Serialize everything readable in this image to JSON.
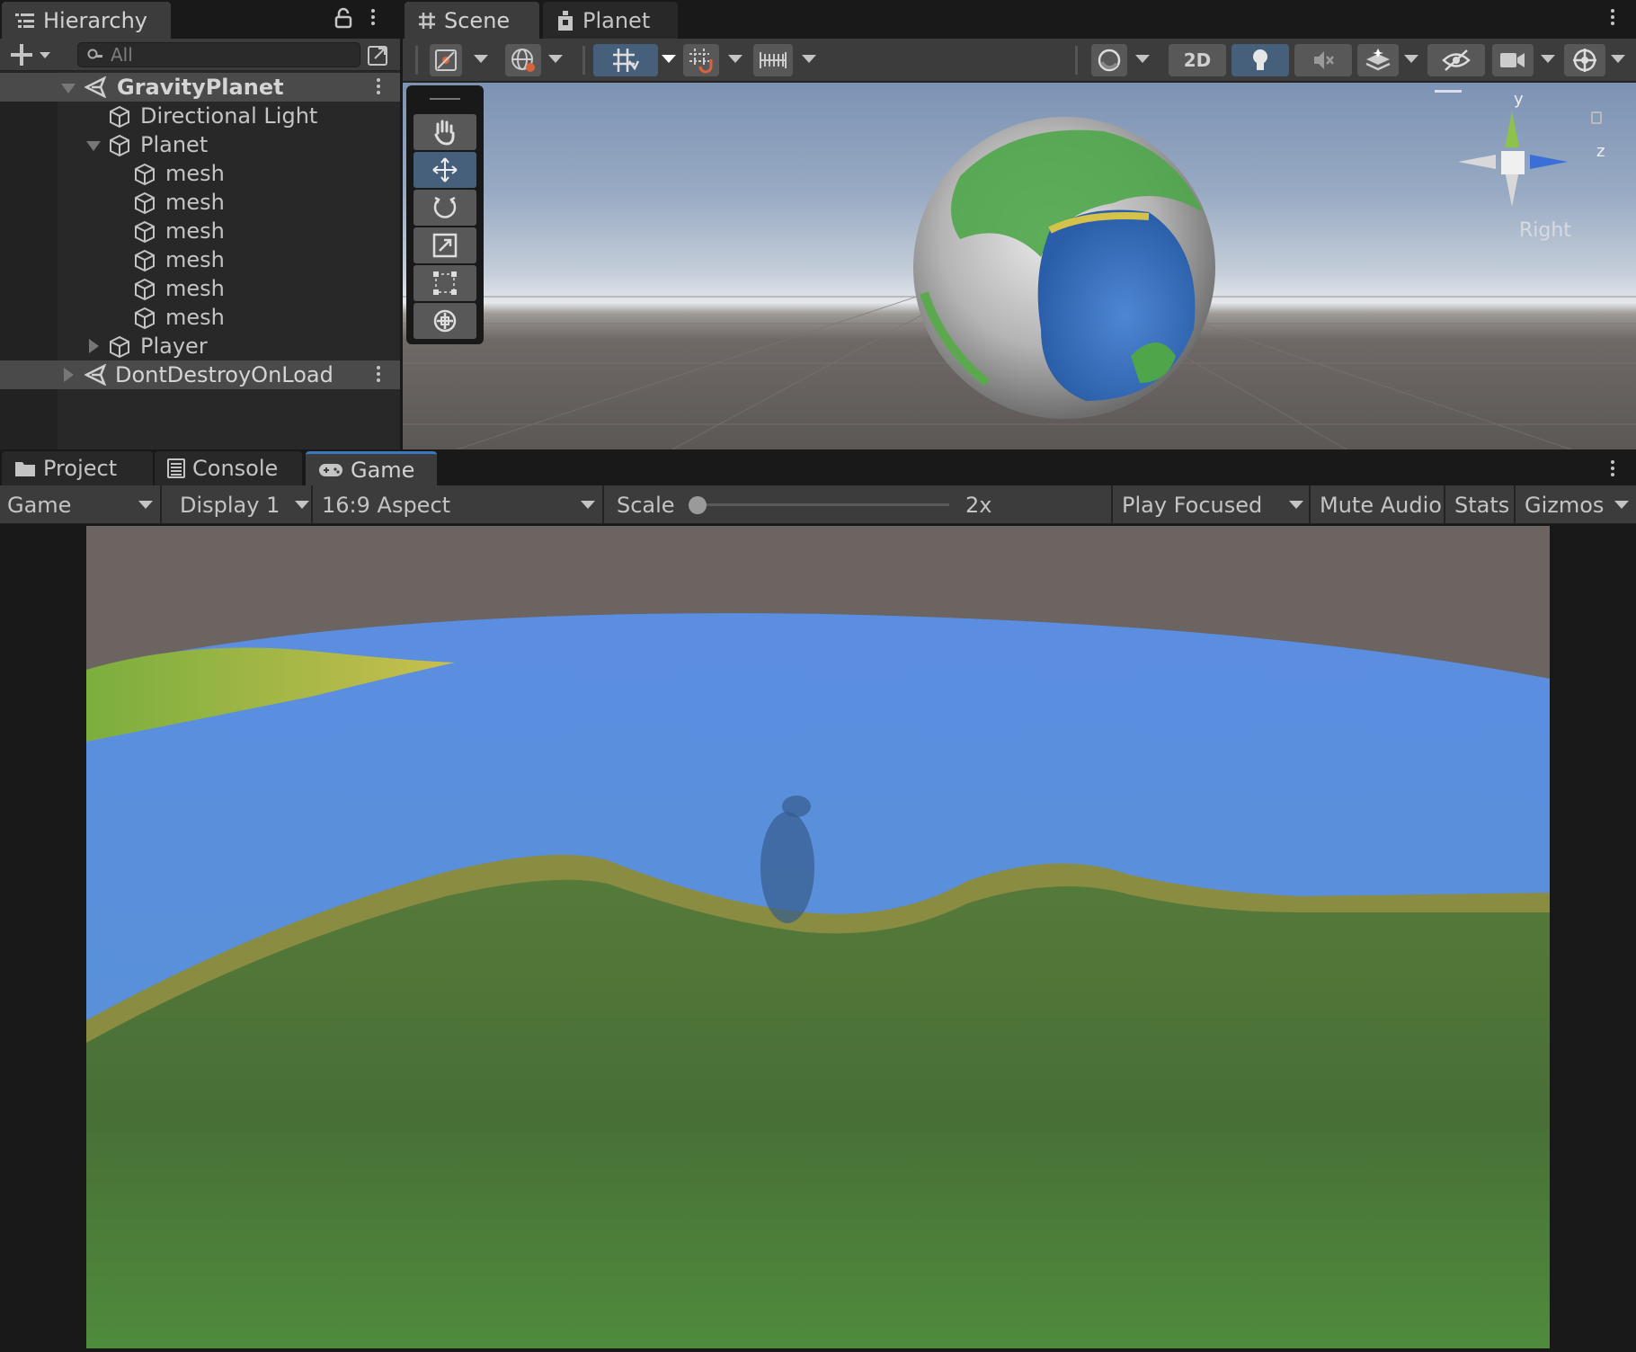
{
  "hierarchy": {
    "tab_label": "Hierarchy",
    "search_placeholder": "All",
    "items": [
      {
        "label": "GravityPlanet",
        "kind": "scene"
      },
      {
        "label": "Directional Light",
        "kind": "object"
      },
      {
        "label": "Planet",
        "kind": "object"
      },
      {
        "label": "mesh",
        "kind": "object"
      },
      {
        "label": "mesh",
        "kind": "object"
      },
      {
        "label": "mesh",
        "kind": "object"
      },
      {
        "label": "mesh",
        "kind": "object"
      },
      {
        "label": "mesh",
        "kind": "object"
      },
      {
        "label": "mesh",
        "kind": "object"
      },
      {
        "label": "Player",
        "kind": "object"
      },
      {
        "label": "DontDestroyOnLoad",
        "kind": "scene"
      }
    ]
  },
  "scene_view": {
    "tabs": [
      {
        "label": "Scene",
        "icon": "grid-hash-icon"
      },
      {
        "label": "Planet",
        "icon": "prefab-icon"
      }
    ],
    "toggle_2d_label": "2D",
    "gizmo": {
      "axis_y": "y",
      "axis_z": "z",
      "view_label": "Right"
    },
    "tools": [
      "hand-tool",
      "move-tool",
      "rotate-tool",
      "scale-tool",
      "rect-tool",
      "transform-tool"
    ]
  },
  "bottom_panel": {
    "tabs": [
      {
        "label": "Project",
        "icon": "folder-icon"
      },
      {
        "label": "Console",
        "icon": "console-icon"
      },
      {
        "label": "Game",
        "icon": "gamepad-icon"
      }
    ]
  },
  "game_toolbar": {
    "view_mode": "Game",
    "display": "Display 1",
    "aspect": "16:9 Aspect",
    "scale_label": "Scale",
    "scale_value": "2x",
    "scale_slider_fraction": 0.0,
    "play_mode": "Play Focused",
    "mute_audio": "Mute Audio",
    "stats": "Stats",
    "gizmos": "Gizmos"
  },
  "colors": {
    "panel_bg": "#282828",
    "toolbar_bg": "#3c3c3c",
    "accent_blue": "#46607c",
    "tab_highlight": "#3a79bb"
  }
}
